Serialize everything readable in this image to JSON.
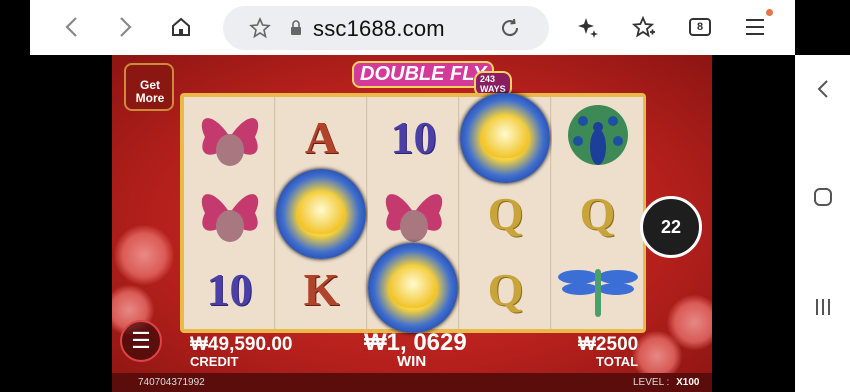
{
  "browser": {
    "url": "ssc1688.com",
    "tab_count": "8",
    "icons": [
      "back-icon",
      "forward-icon",
      "home-icon",
      "star-icon",
      "lock-icon",
      "reload-icon",
      "sparkle-icon",
      "bookmark-star-icon",
      "tabs-icon",
      "menu-icon"
    ]
  },
  "game": {
    "title": "DOUBLE FLY",
    "ways": "243 WAYS",
    "get_more": "Get More",
    "spin_count": "22",
    "credit_value": "₩49,590.00",
    "credit_label": "CREDIT",
    "win_value": "₩1, 0629",
    "win_label": "WIN",
    "total_value": "₩2500",
    "total_label": "TOTAL",
    "game_id": "740704371992",
    "level_label": "LEVEL :",
    "level_value": "X100",
    "reels": [
      [
        "butterflies",
        "butterflies",
        "10"
      ],
      [
        "A",
        "lotus",
        "K"
      ],
      [
        "10",
        "butterflies",
        "lotus"
      ],
      [
        "lotus",
        "Q",
        "Q"
      ],
      [
        "peacock",
        "Q",
        "dragonfly"
      ]
    ]
  },
  "colors": {
    "background_red": "#c42620",
    "gold": "#e9b94a",
    "reel_bg": "#eedfcd"
  }
}
